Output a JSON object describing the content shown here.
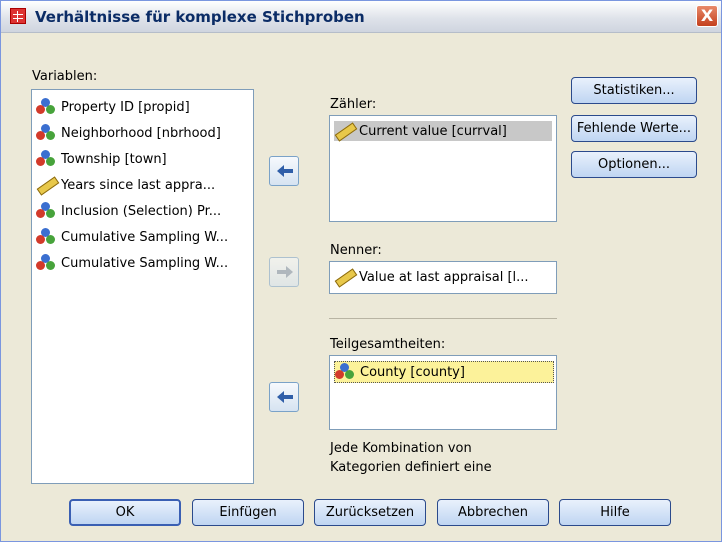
{
  "window": {
    "title": "Verhältnisse für komplexe Stichproben",
    "close": "X"
  },
  "variables": {
    "label": "Variablen:",
    "items": [
      {
        "icon": "nominal-icon",
        "label": "Property ID [propid]"
      },
      {
        "icon": "nominal-icon",
        "label": "Neighborhood [nbrhood]"
      },
      {
        "icon": "nominal-icon",
        "label": "Township [town]"
      },
      {
        "icon": "scale-icon",
        "label": "Years since last appra..."
      },
      {
        "icon": "nominal-icon",
        "label": "Inclusion (Selection) Pr..."
      },
      {
        "icon": "nominal-icon",
        "label": "Cumulative Sampling W..."
      },
      {
        "icon": "nominal-icon",
        "label": "Cumulative Sampling W..."
      }
    ]
  },
  "numerator": {
    "label": "Zähler:",
    "item": "Current value [currval]"
  },
  "denominator": {
    "label": "Nenner:",
    "item": "Value at last appraisal [l..."
  },
  "subpopulations": {
    "label": "Teilgesamtheiten:",
    "item": "County [county]",
    "note_line1": "Jede Kombination von",
    "note_line2": "Kategorien definiert eine"
  },
  "side_buttons": {
    "statistics": "Statistiken...",
    "missing": "Fehlende Werte...",
    "options": "Optionen..."
  },
  "bottom_buttons": {
    "ok": "OK",
    "paste": "Einfügen",
    "reset": "Zurücksetzen",
    "cancel": "Abbrechen",
    "help": "Hilfe"
  }
}
